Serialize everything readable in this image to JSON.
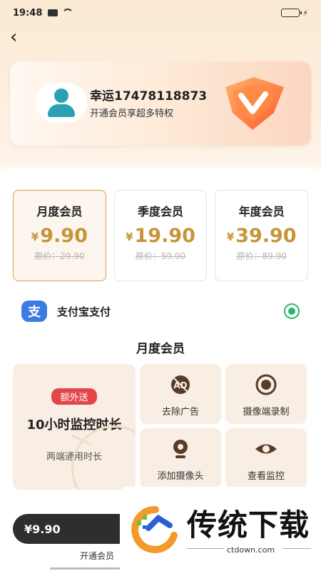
{
  "status": {
    "time": "19:48"
  },
  "user": {
    "name": "幸运17478118873",
    "subtitle": "开通会员享超多特权"
  },
  "plans": [
    {
      "title": "月度会员",
      "currency": "¥",
      "price": "9.90",
      "original": "原价：29.90",
      "selected": true
    },
    {
      "title": "季度会员",
      "currency": "¥",
      "price": "19.90",
      "original": "原价：59.90",
      "selected": false
    },
    {
      "title": "年度会员",
      "currency": "¥",
      "price": "39.90",
      "original": "原价：89.90",
      "selected": false
    }
  ],
  "payment": {
    "icon_char": "支",
    "label": "支付宝支付",
    "selected": true
  },
  "section_title": "月度会员",
  "benefits": {
    "big": {
      "badge": "额外送",
      "title": "10小时监控时长",
      "subtitle": "两端通用时长"
    },
    "items": [
      {
        "label": "去除广告",
        "icon": "no-ad-icon"
      },
      {
        "label": "摄像端录制",
        "icon": "record-icon"
      },
      {
        "label": "添加摄像头",
        "icon": "camera-icon"
      },
      {
        "label": "查看监控",
        "icon": "eye-icon"
      }
    ]
  },
  "bottom": {
    "price_text": "¥9.90",
    "open_label": "开通会员"
  },
  "watermark": {
    "text": "传统下载",
    "url": "ctdown.com"
  },
  "colors": {
    "accent_gold": "#c79539",
    "selected_green": "#2ab56c",
    "badge_red": "#e4454a",
    "dark_pill": "#2e2e2e"
  }
}
